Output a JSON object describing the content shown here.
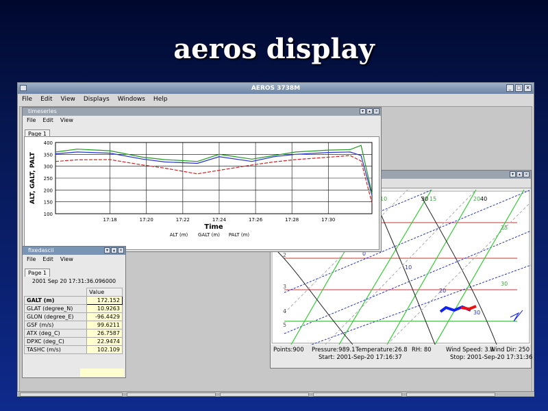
{
  "slide_title": "aeros display",
  "main_window": {
    "title": "AEROS 3738M",
    "menu": [
      "File",
      "Edit",
      "View",
      "Displays",
      "Windows",
      "Help"
    ]
  },
  "timeseries": {
    "title": "timeseries",
    "menu": [
      "File",
      "Edit",
      "View"
    ],
    "tab": "Page 1",
    "chart_data": {
      "type": "line",
      "xlabel": "Time",
      "ylabel": "ALT, GALT, PALT",
      "ylim": [
        100,
        400
      ],
      "xlim": [
        17.25,
        17.54
      ],
      "yticks": [
        "100",
        "150",
        "200",
        "250",
        "300",
        "350",
        "400"
      ],
      "xticks": [
        "17:18",
        "17:20",
        "17:22",
        "17:24",
        "17:26",
        "17:28",
        "17:30"
      ],
      "x": [
        17.25,
        17.27,
        17.3,
        17.33,
        17.35,
        17.38,
        17.4,
        17.43,
        17.45,
        17.47,
        17.5,
        17.52,
        17.53,
        17.54
      ],
      "series": [
        {
          "name": "ALT (m)",
          "color": "#cc2222",
          "values": [
            320,
            327,
            328,
            305,
            292,
            268,
            283,
            305,
            318,
            328,
            338,
            345,
            322,
            145
          ]
        },
        {
          "name": "GALT (m)",
          "color": "#2233cc",
          "values": [
            352,
            360,
            355,
            330,
            318,
            312,
            340,
            320,
            340,
            350,
            358,
            360,
            345,
            178
          ]
        },
        {
          "name": "PALT (m)",
          "color": "#229922",
          "values": [
            360,
            372,
            365,
            338,
            328,
            320,
            350,
            330,
            345,
            360,
            368,
            370,
            388,
            185
          ]
        }
      ]
    },
    "legend": [
      "ALT (m)",
      "GALT (m)",
      "PALT (m)"
    ]
  },
  "fixedascii": {
    "title": "fixedascii",
    "menu": [
      "File",
      "Edit",
      "View"
    ],
    "tab": "Page 1",
    "timestamp": "2001 Sep 20 17:31:36.096000",
    "header": "Value",
    "rows": [
      {
        "label": "GALT (m)",
        "value": "172.152"
      },
      {
        "label": "GLAT (degree_N)",
        "value": "10.9263"
      },
      {
        "label": "GLON (degree_E)",
        "value": "-96.4429"
      },
      {
        "label": "GSF (m/s)",
        "value": "99.6211"
      },
      {
        "label": "ATX (deg_C)",
        "value": "26.7587"
      },
      {
        "label": "DPXC (deg_C)",
        "value": "22.9474"
      },
      {
        "label": "TASHC (m/s)",
        "value": "102.109"
      }
    ]
  },
  "skewt": {
    "labels_top": [
      "10",
      "30",
      "15",
      "20",
      "40"
    ],
    "labels_side": [
      "25",
      "0",
      "10",
      "20",
      "30",
      "30"
    ],
    "y_labels": [
      "2",
      "3",
      "4",
      "5"
    ],
    "status": {
      "points": "Points:900",
      "pressure": "Pressure:989.1",
      "temperature": "Temperature:26.8",
      "rh": "RH: 80",
      "wind_speed": "Wind Speed: 3.3",
      "wind_dir": "Wind Dir: 250",
      "start": "Start: 2001-Sep-20 17:16:37",
      "stop": "Stop: 2001-Sep-20 17:31:36"
    }
  },
  "colors": {
    "accent": "#7a94b4",
    "title": "#ffffff"
  }
}
